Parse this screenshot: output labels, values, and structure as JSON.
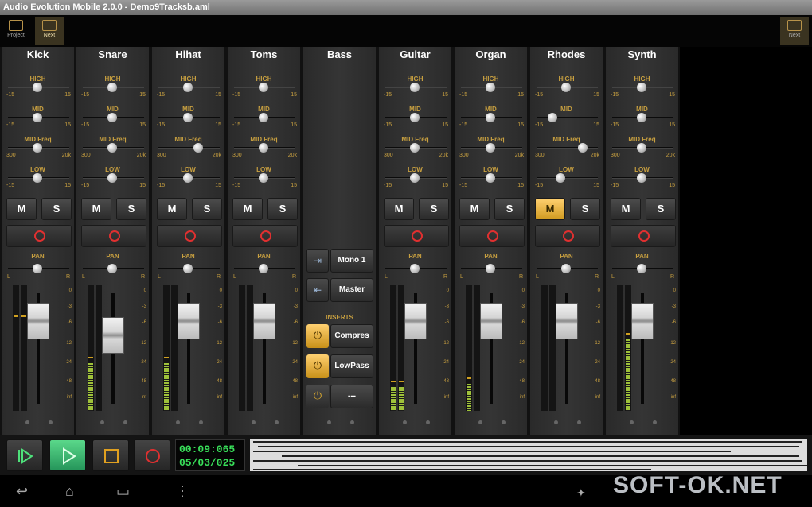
{
  "window": {
    "title": "Audio Evolution Mobile 2.0.0 - Demo9Tracksb.aml"
  },
  "toolbar": {
    "project_label": "Project",
    "next_label": "Next"
  },
  "strips": [
    {
      "name": "Kick",
      "high_label": "HIGH",
      "mid_label": "MID",
      "midfreq_label": "MID Freq",
      "low_label": "LOW",
      "range_min": "-15",
      "range_max": "15",
      "freq_min": "300",
      "freq_max": "20k",
      "mute": "M",
      "solo": "S",
      "muted": false
    },
    {
      "name": "Snare",
      "high_label": "HIGH",
      "mid_label": "MID",
      "midfreq_label": "MID Freq",
      "low_label": "LOW",
      "range_min": "-15",
      "range_max": "15",
      "freq_min": "300",
      "freq_max": "20k",
      "mute": "M",
      "solo": "S",
      "muted": false
    },
    {
      "name": "Hihat",
      "high_label": "HIGH",
      "mid_label": "MID",
      "midfreq_label": "MID Freq",
      "low_label": "LOW",
      "range_min": "-15",
      "range_max": "15",
      "freq_min": "300",
      "freq_max": "20k",
      "mute": "M",
      "solo": "S",
      "muted": false
    },
    {
      "name": "Toms",
      "high_label": "HIGH",
      "mid_label": "MID",
      "midfreq_label": "MID Freq",
      "low_label": "LOW",
      "range_min": "-15",
      "range_max": "15",
      "freq_min": "300",
      "freq_max": "20k",
      "mute": "M",
      "solo": "S",
      "muted": false
    },
    {
      "name": "Guitar",
      "high_label": "HIGH",
      "mid_label": "MID",
      "midfreq_label": "MID Freq",
      "low_label": "LOW",
      "range_min": "-15",
      "range_max": "15",
      "freq_min": "300",
      "freq_max": "20k",
      "mute": "M",
      "solo": "S",
      "muted": false
    },
    {
      "name": "Organ",
      "high_label": "HIGH",
      "mid_label": "MID",
      "midfreq_label": "MID Freq",
      "low_label": "LOW",
      "range_min": "-15",
      "range_max": "15",
      "freq_min": "300",
      "freq_max": "20k",
      "mute": "M",
      "solo": "S",
      "muted": false
    },
    {
      "name": "Rhodes",
      "high_label": "HIGH",
      "mid_label": "MID",
      "midfreq_label": "MID Freq",
      "low_label": "LOW",
      "range_min": "-15",
      "range_max": "15",
      "freq_min": "300",
      "freq_max": "20k",
      "mute": "M",
      "solo": "S",
      "muted": true
    },
    {
      "name": "Synth",
      "high_label": "HIGH",
      "mid_label": "MID",
      "midfreq_label": "MID Freq",
      "low_label": "LOW",
      "range_min": "-15",
      "range_max": "15",
      "freq_min": "300",
      "freq_max": "20k",
      "mute": "M",
      "solo": "S",
      "muted": false
    }
  ],
  "bass": {
    "name": "Bass",
    "route1": "Mono 1",
    "route2": "Master",
    "inserts_label": "INSERTS",
    "insert1": "Compres",
    "insert2": "LowPass",
    "insert3": "---"
  },
  "labels": {
    "pan": "PAN",
    "left": "L",
    "right": "R"
  },
  "scale": [
    "0",
    "-3",
    "-6",
    "-12",
    "-24",
    "-48",
    "-inf"
  ],
  "transport": {
    "time": "00:09:065",
    "bars": "05/03/025"
  },
  "watermark": "SOFT-OK.NET",
  "colors": {
    "accent": "#c8a040",
    "time_green": "#39e05a",
    "meter_green": "#9fc23a",
    "record_red": "#e03030"
  }
}
